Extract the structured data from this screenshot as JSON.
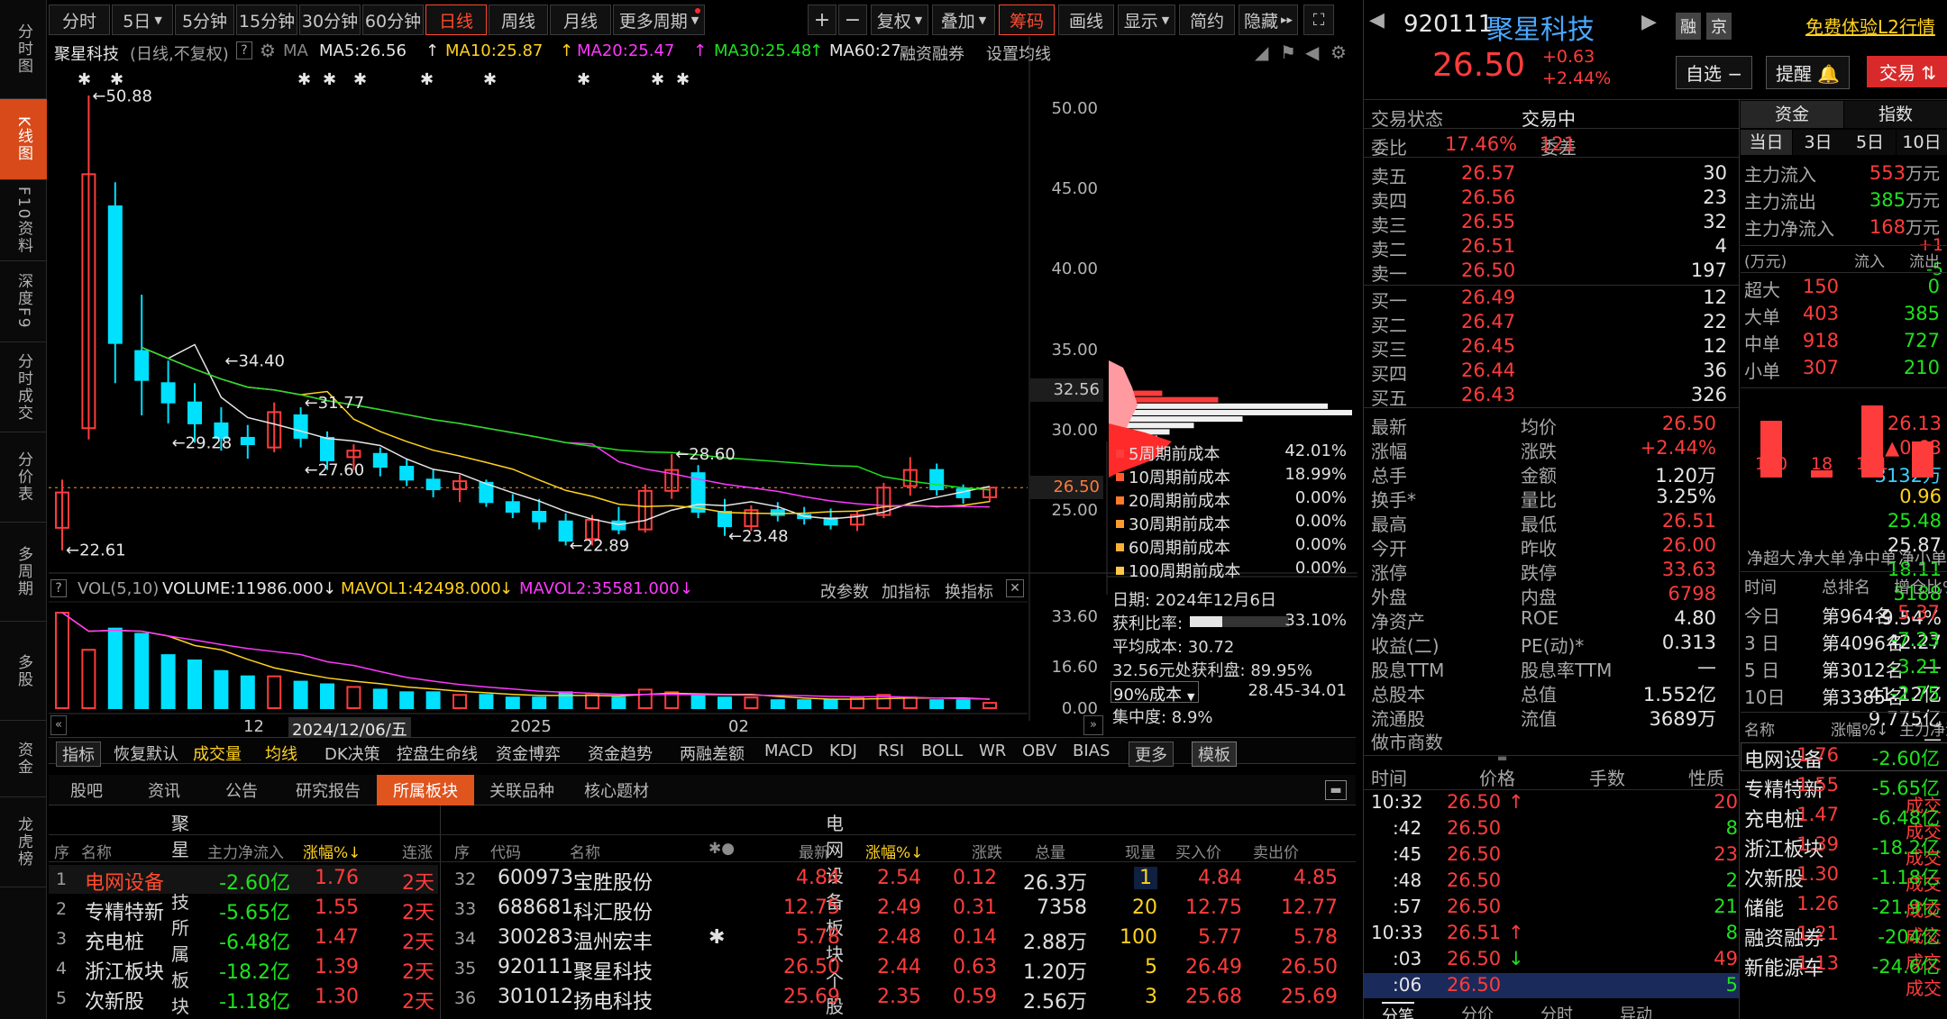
{
  "leftnav": [
    {
      "label": "分时图",
      "active": false
    },
    {
      "label": "K线图",
      "active": true
    },
    {
      "label": "F10资料",
      "active": false
    },
    {
      "label": "深度F9",
      "active": false
    },
    {
      "label": "分时成交",
      "active": false
    },
    {
      "label": "分价表",
      "active": false
    },
    {
      "label": "多周期",
      "active": false
    },
    {
      "label": "多股",
      "active": false
    },
    {
      "label": "资金",
      "active": false
    },
    {
      "label": "龙虎榜",
      "active": false
    }
  ],
  "toolbar": {
    "periods": [
      "分时",
      "5日",
      "5分钟",
      "15分钟",
      "30分钟",
      "60分钟",
      "日线",
      "周线",
      "月线",
      "更多周期"
    ],
    "active_period": "日线",
    "plus": "+",
    "minus": "−",
    "tools": [
      "复权",
      "叠加",
      "筹码",
      "画线",
      "显示",
      "简约",
      "隐藏"
    ],
    "active_tool": "筹码"
  },
  "mabar": {
    "name": "聚星科技",
    "mode": "(日线,不复权)",
    "ma": "MA",
    "ma5": "MA5:26.56",
    "ma10": "MA10:25.87",
    "ma20": "MA20:25.47",
    "ma30": "MA30:25.48",
    "ma60": "MA60:27.",
    "margin": "融资融券",
    "setting": "设置均线"
  },
  "chart_data": {
    "type": "candlestick",
    "price_axis": [
      50.0,
      45.0,
      40.0,
      35.0,
      30.0,
      25.0
    ],
    "price_range": [
      21.0,
      52.0
    ],
    "current_price": "26.50",
    "cost_price": "32.56",
    "annotations": [
      "50.88",
      "34.40",
      "31.77",
      "29.28",
      "27.60",
      "28.60",
      "22.61",
      "22.89",
      "23.48"
    ],
    "x_labels": [
      "12",
      "2024/12/06/五",
      "2025",
      "02"
    ],
    "candles": [
      [
        24.0,
        27.0,
        22.6,
        26.2
      ],
      [
        30.2,
        50.9,
        29.5,
        46.0
      ],
      [
        44.0,
        45.5,
        33.0,
        35.5
      ],
      [
        35.0,
        38.5,
        31.0,
        33.2
      ],
      [
        33.0,
        34.4,
        30.5,
        31.8
      ],
      [
        31.8,
        33.0,
        29.3,
        30.5
      ],
      [
        30.5,
        31.5,
        28.8,
        29.6
      ],
      [
        29.6,
        30.4,
        28.3,
        29.2
      ],
      [
        29.0,
        31.8,
        28.7,
        31.2
      ],
      [
        31.0,
        31.5,
        29.0,
        29.6
      ],
      [
        29.6,
        30.0,
        27.6,
        28.2
      ],
      [
        28.4,
        29.2,
        27.6,
        28.8
      ],
      [
        28.6,
        29.0,
        27.2,
        27.8
      ],
      [
        27.8,
        28.3,
        26.6,
        27.0
      ],
      [
        27.0,
        27.6,
        25.9,
        26.4
      ],
      [
        26.4,
        27.3,
        25.6,
        26.9
      ],
      [
        26.8,
        27.0,
        25.3,
        25.6
      ],
      [
        25.6,
        26.1,
        24.6,
        25.0
      ],
      [
        25.0,
        25.8,
        23.9,
        24.4
      ],
      [
        24.4,
        24.9,
        22.9,
        23.2
      ],
      [
        23.3,
        24.8,
        22.9,
        24.5
      ],
      [
        24.4,
        25.3,
        23.6,
        23.9
      ],
      [
        23.9,
        26.7,
        23.7,
        26.3
      ],
      [
        26.3,
        28.6,
        25.8,
        27.6
      ],
      [
        27.4,
        27.9,
        24.6,
        25.0
      ],
      [
        25.0,
        25.8,
        23.5,
        24.1
      ],
      [
        24.1,
        25.4,
        23.8,
        25.1
      ],
      [
        25.1,
        25.6,
        24.4,
        24.8
      ],
      [
        24.8,
        25.3,
        24.2,
        24.6
      ],
      [
        24.6,
        25.2,
        23.9,
        24.2
      ],
      [
        24.2,
        25.0,
        23.8,
        24.8
      ],
      [
        24.8,
        26.8,
        24.6,
        26.5
      ],
      [
        26.6,
        28.4,
        26.0,
        27.6
      ],
      [
        27.6,
        28.0,
        26.0,
        26.4
      ],
      [
        26.4,
        26.7,
        25.5,
        25.9
      ],
      [
        25.9,
        26.5,
        25.6,
        26.5
      ]
    ],
    "volume_axis": [
      "33.60",
      "16.60",
      "0.00"
    ],
    "volume_range": [
      0,
      36
    ],
    "volumes": [
      36,
      22,
      30,
      28,
      20,
      18,
      14,
      12,
      12,
      10,
      9,
      8,
      7,
      6,
      6,
      5,
      5,
      4,
      4,
      6,
      5,
      4,
      7,
      6,
      5,
      4,
      4,
      3,
      3,
      3,
      4,
      5,
      4,
      3,
      3,
      2
    ]
  },
  "volbar": {
    "q": "?",
    "vol": "VOL(5,10)",
    "volume": "VOLUME:11986.000",
    "mavol1": "MAVOL1:42498.000",
    "mavol2": "MAVOL2:35581.000",
    "gaicanshu": "改参数",
    "jiazhibiao": "加指标",
    "huanzhibiao": "换指标"
  },
  "cost": {
    "rows": [
      {
        "label": "5周期前成本",
        "value": "42.01%",
        "color": "#ff3c3c"
      },
      {
        "label": "10周期前成本",
        "value": "18.99%",
        "color": "#ff5a2a"
      },
      {
        "label": "20周期前成本",
        "value": "0.00%",
        "color": "#ff7a2a"
      },
      {
        "label": "30周期前成本",
        "value": "0.00%",
        "color": "#ff9a2e"
      },
      {
        "label": "60周期前成本",
        "value": "0.00%",
        "color": "#ffb03a"
      },
      {
        "label": "100周期前成本",
        "value": "0.00%",
        "color": "#ffc84a"
      }
    ],
    "date": "日期: 2024年12月6日",
    "profit_label": "获利比率:",
    "profit_value": "33.10%",
    "avgcost": "平均成本: 30.72",
    "profitplate": "32.56元处获利盘: 89.95%",
    "cost90": "90%成本",
    "cost90range": "28.45-34.01",
    "concentration": "集中度: 8.9%"
  },
  "indbar": [
    "指标",
    "恢复默认",
    "成交量",
    "均线",
    "DK决策",
    "控盘生命线",
    "资金博弈",
    "资金趋势",
    "两融差额",
    "MACD",
    "KDJ",
    "RSI",
    "BOLL",
    "WR",
    "OBV",
    "BIAS",
    "更多",
    "模板"
  ],
  "bottom": {
    "tabs": [
      "股吧",
      "资讯",
      "公告",
      "研究报告",
      "所属板块",
      "关联品种",
      "核心题材"
    ],
    "active_tab": "所属板块",
    "left_title": "聚星科技所属板块",
    "right_title": "电网设备板块个股",
    "left_headers": [
      "序",
      "名称",
      "主力净流入",
      "涨幅%↓",
      "连涨"
    ],
    "left_rows": [
      [
        "1",
        "电网设备",
        "-2.60亿",
        "1.76",
        "2天"
      ],
      [
        "2",
        "专精特新",
        "-5.65亿",
        "1.55",
        "2天"
      ],
      [
        "3",
        "充电桩",
        "-6.48亿",
        "1.47",
        "2天"
      ],
      [
        "4",
        "浙江板块",
        "-18.2亿",
        "1.39",
        "2天"
      ],
      [
        "5",
        "次新股",
        "-1.18亿",
        "1.30",
        "2天"
      ]
    ],
    "right_headers": [
      "序",
      "代码",
      "名称",
      "✱●",
      "最新",
      "涨幅%↓",
      "涨跌",
      "总量",
      "现量",
      "买入价",
      "卖出价"
    ],
    "right_rows": [
      [
        "32",
        "600973",
        "宝胜股份",
        "",
        "4.84",
        "2.54",
        "0.12",
        "26.3万",
        "1",
        "4.84",
        "4.85"
      ],
      [
        "33",
        "688681",
        "科汇股份",
        "",
        "12.75",
        "2.49",
        "0.31",
        "7358",
        "20",
        "12.75",
        "12.77"
      ],
      [
        "34",
        "300283",
        "温州宏丰",
        "✱",
        "5.78",
        "2.48",
        "0.14",
        "2.88万",
        "100",
        "5.77",
        "5.78"
      ],
      [
        "35",
        "920111",
        "聚星科技",
        "",
        "26.50",
        "2.44",
        "0.63",
        "1.20万",
        "5",
        "26.49",
        "26.50"
      ],
      [
        "36",
        "301012",
        "扬电科技",
        "",
        "25.69",
        "2.35",
        "0.59",
        "2.56万",
        "3",
        "25.68",
        "25.69"
      ]
    ]
  },
  "quote": {
    "code": "920111",
    "name": "聚星科技",
    "tag1": "融",
    "tag2": "京",
    "l2": "免费体验L2行情",
    "price": "26.50",
    "change": "+0.63",
    "pct": "+2.44%",
    "zixuan": "自选 −",
    "tixing": "提醒",
    "jiaoyi": "交易",
    "status_label": "交易状态",
    "status": "交易中",
    "weibi_label": "委比",
    "weibi": "17.46%",
    "weicha_label": "委差",
    "weicha": "121",
    "asks": [
      {
        "label": "卖五",
        "price": "26.57",
        "vol": "30",
        "chg": ""
      },
      {
        "label": "卖四",
        "price": "26.56",
        "vol": "23",
        "chg": ""
      },
      {
        "label": "卖三",
        "price": "26.55",
        "vol": "32",
        "chg": ""
      },
      {
        "label": "卖二",
        "price": "26.51",
        "vol": "4",
        "chg": "+1"
      },
      {
        "label": "卖一",
        "price": "26.50",
        "vol": "197",
        "chg": "-5"
      }
    ],
    "bids": [
      {
        "label": "买一",
        "price": "26.49",
        "vol": "12",
        "chg": ""
      },
      {
        "label": "买二",
        "price": "26.47",
        "vol": "22",
        "chg": ""
      },
      {
        "label": "买三",
        "price": "26.45",
        "vol": "12",
        "chg": ""
      },
      {
        "label": "买四",
        "price": "26.44",
        "vol": "36",
        "chg": ""
      },
      {
        "label": "买五",
        "price": "26.43",
        "vol": "326",
        "chg": ""
      }
    ],
    "stats": [
      [
        "最新",
        "26.50",
        "red",
        "均价",
        "26.13",
        "red"
      ],
      [
        "涨幅",
        "+2.44%",
        "red",
        "涨跌",
        "▲0.63",
        "red"
      ],
      [
        "总手",
        "1.20万",
        "white",
        "金额",
        "3132万",
        "cyan"
      ],
      [
        "换手*",
        "3.25%",
        "white",
        "量比",
        "0.96",
        "yellow"
      ],
      [
        "最高",
        "26.51",
        "red",
        "最低",
        "25.48",
        "green"
      ],
      [
        "今开",
        "26.00",
        "red",
        "昨收",
        "25.87",
        "white"
      ],
      [
        "涨停",
        "33.63",
        "red",
        "跌停",
        "18.11",
        "green"
      ],
      [
        "外盘",
        "6798",
        "red",
        "内盘",
        "5188",
        "green"
      ],
      [
        "净资产",
        "4.80",
        "white",
        "ROE",
        "9.54%",
        "white"
      ],
      [
        "收益(二)",
        "0.313",
        "white",
        "PE(动)*",
        "42.27",
        "white"
      ],
      [
        "股息TTM",
        "—",
        "white",
        "股息率TTM",
        "—",
        "white"
      ],
      [
        "总股本",
        "1.552亿",
        "white",
        "总值",
        "41.12亿",
        "white"
      ],
      [
        "流通股",
        "3689万",
        "white",
        "流值",
        "9.775亿",
        "white"
      ]
    ],
    "zuoshi": "做市商数",
    "zuoshi_val": "—",
    "ticks_headers": [
      "时间",
      "价格",
      "手数",
      "性质"
    ],
    "ticks": [
      [
        "10:32",
        "26.50",
        "↑",
        "20",
        "成交"
      ],
      [
        ":42",
        "26.50",
        "",
        "8",
        "成交"
      ],
      [
        ":45",
        "26.50",
        "",
        "23",
        "成交"
      ],
      [
        ":48",
        "26.50",
        "",
        "2",
        "成交"
      ],
      [
        ":57",
        "26.50",
        "",
        "21",
        "成交"
      ],
      [
        "10:33",
        "26.51",
        "↑",
        "8",
        "成交"
      ],
      [
        ":03",
        "26.50",
        "↓",
        "49",
        "成交"
      ],
      [
        ":06",
        "26.50",
        "",
        "5",
        "成交"
      ]
    ],
    "bottom_tabs": [
      "分笔",
      "分价",
      "分时",
      "异动"
    ]
  },
  "fund": {
    "tabs": [
      "资金",
      "指数"
    ],
    "periods": [
      "当日",
      "3日",
      "5日",
      "10日"
    ],
    "flows": [
      [
        "主力流入",
        "553",
        "万元",
        "red"
      ],
      [
        "主力流出",
        "385",
        "万元",
        "green"
      ],
      [
        "主力净流入",
        "168",
        "万元",
        "red"
      ]
    ],
    "unit": "(万元)",
    "in": "流入",
    "out": "流出",
    "sizes": [
      [
        "超大",
        "150",
        "0"
      ],
      [
        "大单",
        "403",
        "385"
      ],
      [
        "中单",
        "918",
        "727"
      ],
      [
        "小单",
        "307",
        "210"
      ]
    ],
    "bar_values": [
      150,
      18,
      191,
      96
    ],
    "bar_labels": [
      "150",
      "18",
      "191",
      "96"
    ],
    "bar_names": [
      "净超大",
      "净大单",
      "净中单",
      "净小单"
    ],
    "rank_headers": [
      "时间",
      "总排名",
      "增仓比%"
    ],
    "ranks": [
      [
        "今日",
        "第964名",
        "5.37",
        "red"
      ],
      [
        "3 日",
        "第4096名",
        "-7.23",
        "green"
      ],
      [
        "5 日",
        "第3012名",
        "-3.21",
        "green"
      ],
      [
        "10日",
        "第3385名",
        "-2.75",
        "green"
      ]
    ],
    "sector_headers": [
      "名称",
      "涨幅%↓",
      "主力净流入"
    ],
    "sectors": [
      [
        "电网设备",
        "1.76",
        "-2.60亿"
      ],
      [
        "专精特新",
        "1.55",
        "-5.65亿"
      ],
      [
        "充电桩",
        "1.47",
        "-6.48亿"
      ],
      [
        "浙江板块",
        "1.39",
        "-18.2亿"
      ],
      [
        "次新股",
        "1.30",
        "-1.18亿"
      ],
      [
        "储能",
        "1.26",
        "-21.9亿"
      ],
      [
        "融资融券",
        "1.21",
        "-204亿"
      ],
      [
        "新能源车",
        "1.13",
        "-24.6亿"
      ]
    ]
  }
}
